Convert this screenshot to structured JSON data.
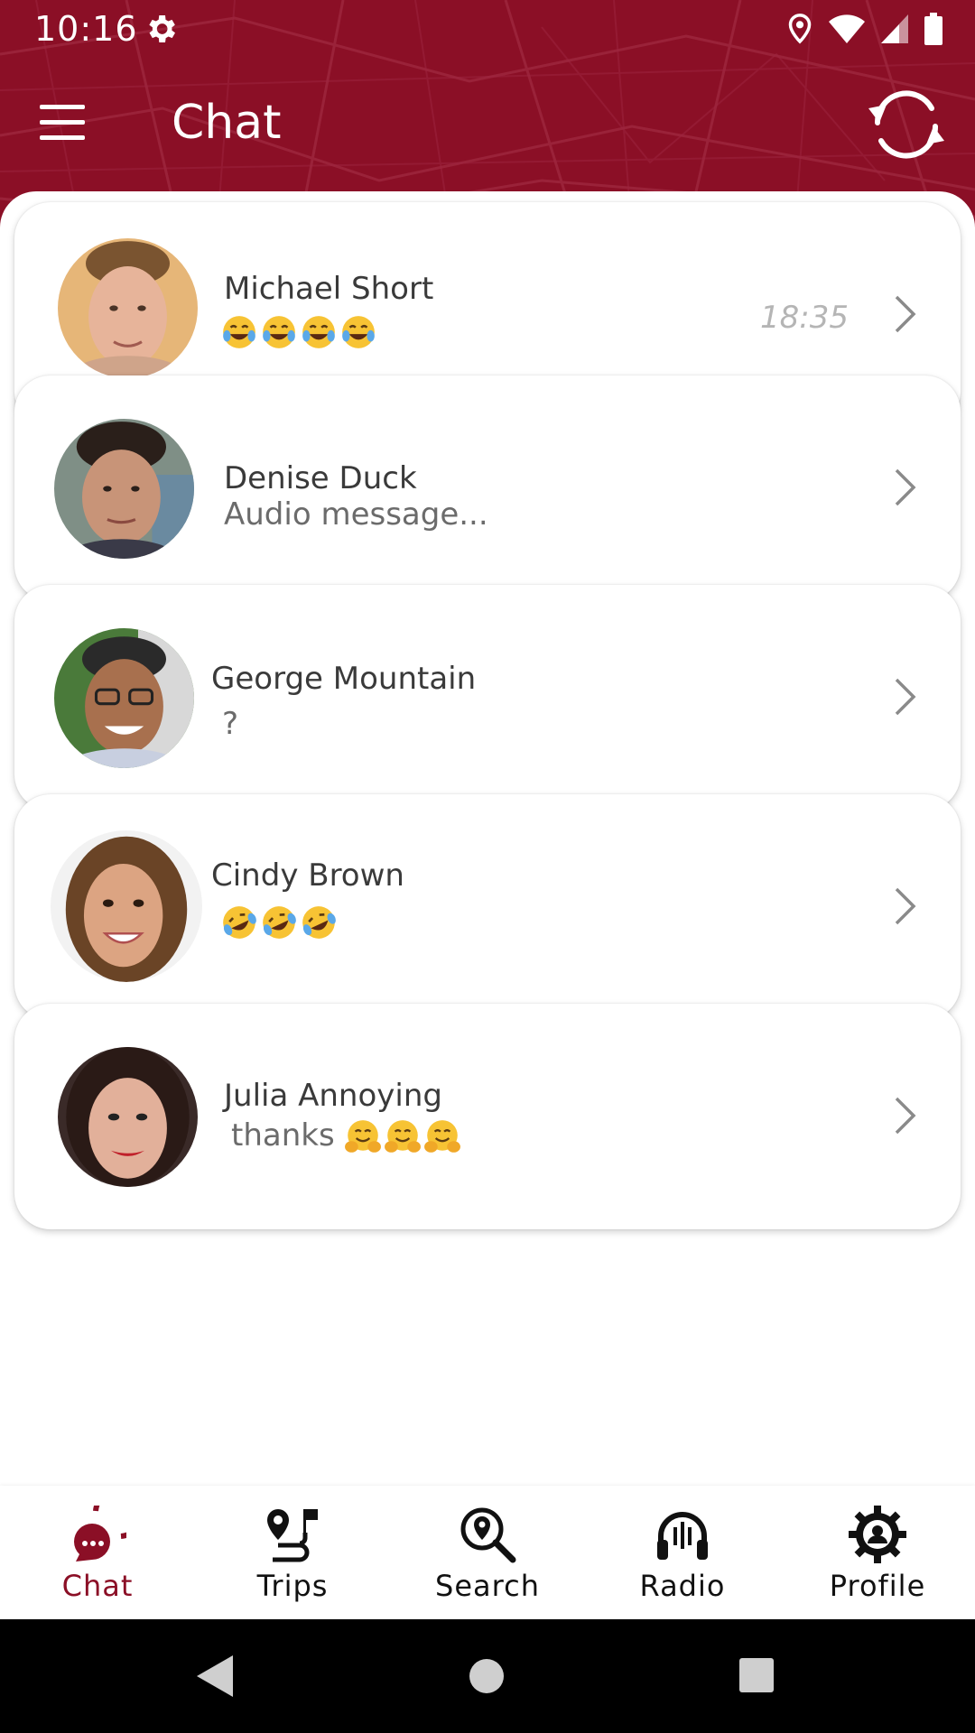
{
  "status_bar": {
    "time": "10:16"
  },
  "header": {
    "title": "Chat"
  },
  "chats": [
    {
      "name": "Michael Short",
      "message": "",
      "emojis": [
        "tears-of-joy",
        "tears-of-joy",
        "tears-of-joy",
        "tears-of-joy"
      ],
      "time": "18:35"
    },
    {
      "name": "Denise Duck",
      "message": "Audio message...",
      "emojis": [],
      "time": ""
    },
    {
      "name": "George Mountain",
      "message": "?",
      "emojis": [],
      "time": ""
    },
    {
      "name": "Cindy Brown",
      "message": "",
      "emojis": [
        "rolling-on-floor-laughing",
        "rolling-on-floor-laughing",
        "rolling-on-floor-laughing"
      ],
      "time": ""
    },
    {
      "name": "Julia Annoying",
      "message": "thanks",
      "emojis": [
        "hugging-face",
        "hugging-face",
        "hugging-face"
      ],
      "time": ""
    }
  ],
  "bottom_nav": [
    {
      "label": "Chat",
      "icon": "chat-bubble-icon",
      "active": true
    },
    {
      "label": "Trips",
      "icon": "route-pin-icon",
      "active": false
    },
    {
      "label": "Search",
      "icon": "search-pin-icon",
      "active": false
    },
    {
      "label": "Radio",
      "icon": "headphones-icon",
      "active": false
    },
    {
      "label": "Profile",
      "icon": "profile-gear-icon",
      "active": false
    }
  ],
  "colors": {
    "brand": "#8b0f26",
    "card_bg": "#ffffff",
    "muted_text": "#6b6b6b",
    "time_text": "#b5b5b5"
  }
}
